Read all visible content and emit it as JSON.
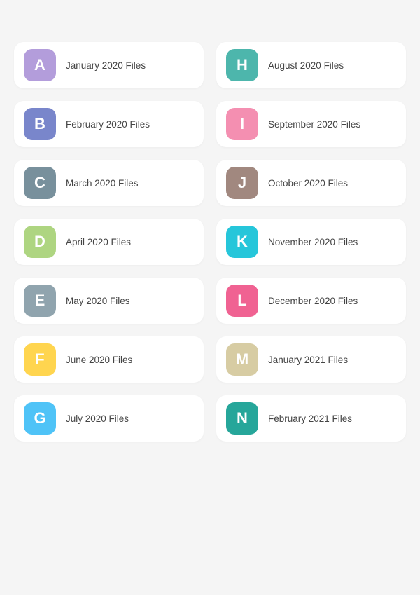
{
  "folders": [
    {
      "id": "a",
      "letter": "A",
      "label": "January 2020 Files",
      "color": "#b39ddb"
    },
    {
      "id": "h",
      "letter": "H",
      "label": "August 2020 Files",
      "color": "#4db6ac"
    },
    {
      "id": "b",
      "letter": "B",
      "label": "February 2020 Files",
      "color": "#7986cb"
    },
    {
      "id": "i",
      "letter": "I",
      "label": "September 2020 Files",
      "color": "#f48fb1"
    },
    {
      "id": "c",
      "letter": "C",
      "label": "March 2020 Files",
      "color": "#78909c"
    },
    {
      "id": "j",
      "letter": "J",
      "label": "October 2020 Files",
      "color": "#a1887f"
    },
    {
      "id": "d",
      "letter": "D",
      "label": "April 2020 Files",
      "color": "#aed581"
    },
    {
      "id": "k",
      "letter": "K",
      "label": "November 2020 Files",
      "color": "#26c6da"
    },
    {
      "id": "e",
      "letter": "E",
      "label": "May 2020 Files",
      "color": "#90a4ae"
    },
    {
      "id": "l",
      "letter": "L",
      "label": "December 2020 Files",
      "color": "#f06292"
    },
    {
      "id": "f",
      "letter": "F",
      "label": "June 2020 Files",
      "color": "#ffd54f"
    },
    {
      "id": "m",
      "letter": "M",
      "label": "January 2021 Files",
      "color": "#d7cca3"
    },
    {
      "id": "g",
      "letter": "G",
      "label": "July 2020 Files",
      "color": "#4fc3f7"
    },
    {
      "id": "n",
      "letter": "N",
      "label": "February 2021 Files",
      "color": "#26a69a"
    }
  ]
}
